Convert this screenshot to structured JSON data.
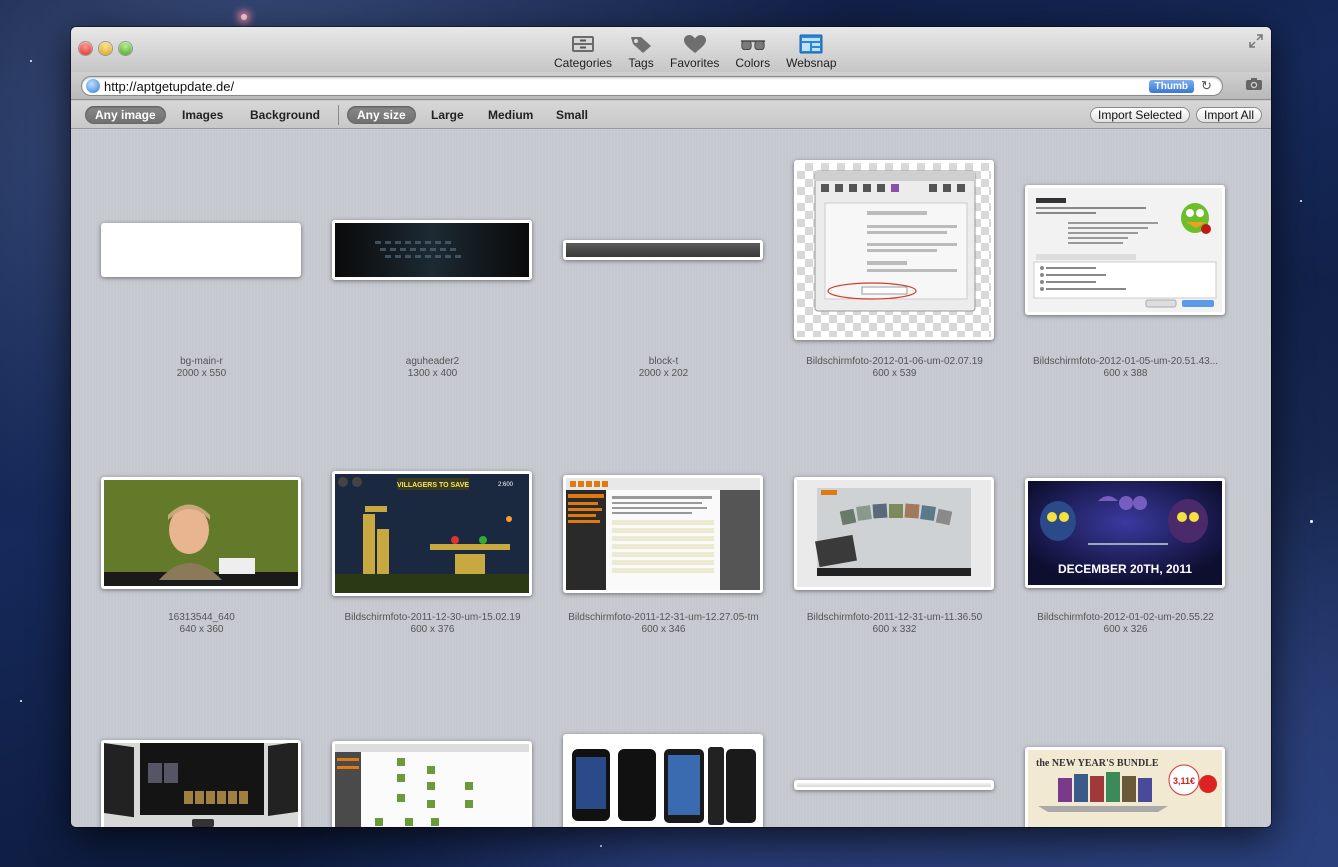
{
  "toolbar": {
    "tabs": [
      {
        "label": "Categories",
        "icon": "cabinet-icon"
      },
      {
        "label": "Tags",
        "icon": "tag-icon"
      },
      {
        "label": "Favorites",
        "icon": "heart-icon"
      },
      {
        "label": "Colors",
        "icon": "glasses-icon"
      },
      {
        "label": "Websnap",
        "icon": "websnap-icon"
      }
    ]
  },
  "urlbar": {
    "url": "http://aptgetupdate.de/",
    "thumb_label": "Thumb"
  },
  "filters": {
    "type": [
      "Any image",
      "Images",
      "Background"
    ],
    "size": [
      "Any size",
      "Large",
      "Medium",
      "Small"
    ],
    "selected_type": "Any image",
    "selected_size": "Any size",
    "import_selected": "Import Selected",
    "import_all": "Import All"
  },
  "images": [
    {
      "name": "bg-main-r",
      "dims": "2000 x 550"
    },
    {
      "name": "aguheader2",
      "dims": "1300 x 400"
    },
    {
      "name": "block-t",
      "dims": "2000 x 202"
    },
    {
      "name": "Bildschirmfoto-2012-01-06-um-02.07.19",
      "dims": "600 x 539"
    },
    {
      "name": "Bildschirmfoto-2012-01-05-um-20.51.43...",
      "dims": "600 x 388"
    },
    {
      "name": "16313544_640",
      "dims": "640 x 360"
    },
    {
      "name": "Bildschirmfoto-2011-12-30-um-15.02.19",
      "dims": "600 x 376"
    },
    {
      "name": "Bildschirmfoto-2011-12-31-um-12.27.05-tm",
      "dims": "600 x 346"
    },
    {
      "name": "Bildschirmfoto-2011-12-31-um-11.36.50",
      "dims": "600 x 332"
    },
    {
      "name": "Bildschirmfoto-2012-01-02-um-20.55.22",
      "dims": "600 x 326"
    }
  ],
  "thumb_text": {
    "game_banner": "VILLAGERS TO SAVE",
    "game_score": "2:600",
    "poster_date": "DECEMBER 20TH, 2011",
    "bundle_title": "the NEW YEAR'S BUNDLE",
    "bundle_price": "3,11€"
  },
  "colors": {
    "accent": "#3b78d4",
    "selected_filter": "#7a7a7a"
  }
}
